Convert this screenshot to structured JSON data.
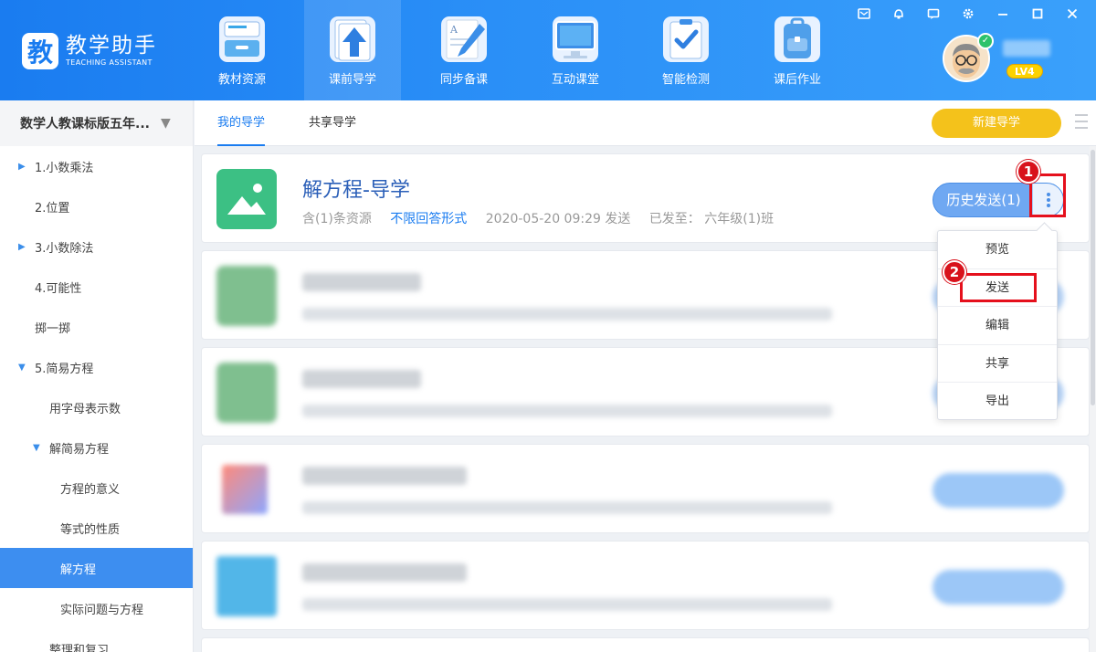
{
  "app": {
    "logo_char": "教",
    "name": "教学助手",
    "subtitle": "TEACHING ASSISTANT",
    "level": "LV4"
  },
  "nav": [
    {
      "label": "教材资源",
      "icon": "cabinet-icon",
      "active": false
    },
    {
      "label": "课前导学",
      "icon": "upload-book-icon",
      "active": true
    },
    {
      "label": "同步备课",
      "icon": "pen-paper-icon",
      "active": false
    },
    {
      "label": "互动课堂",
      "icon": "monitor-icon",
      "active": false
    },
    {
      "label": "智能检测",
      "icon": "checklist-icon",
      "active": false
    },
    {
      "label": "课后作业",
      "icon": "backpack-icon",
      "active": false
    }
  ],
  "window_controls": [
    "mail-icon",
    "bell-icon",
    "chat-icon",
    "gear-icon",
    "minimize-icon",
    "maximize-icon",
    "close-icon"
  ],
  "sidebar": {
    "grade": "数学人教课标版五年...",
    "items": [
      {
        "label": "1.小数乘法",
        "level": 0,
        "caret": "right",
        "selected": false
      },
      {
        "label": "2.位置",
        "level": 0,
        "caret": "",
        "selected": false
      },
      {
        "label": "3.小数除法",
        "level": 0,
        "caret": "right",
        "selected": false
      },
      {
        "label": "4.可能性",
        "level": 0,
        "caret": "",
        "selected": false
      },
      {
        "label": "掷一掷",
        "level": 0,
        "caret": "",
        "selected": false
      },
      {
        "label": "5.简易方程",
        "level": 0,
        "caret": "down",
        "selected": false
      },
      {
        "label": "用字母表示数",
        "level": 1,
        "caret": "",
        "selected": false
      },
      {
        "label": "解简易方程",
        "level": 1,
        "caret": "down",
        "selected": false
      },
      {
        "label": "方程的意义",
        "level": 2,
        "caret": "",
        "selected": false
      },
      {
        "label": "等式的性质",
        "level": 2,
        "caret": "",
        "selected": false
      },
      {
        "label": "解方程",
        "level": 2,
        "caret": "",
        "selected": true
      },
      {
        "label": "实际问题与方程",
        "level": 2,
        "caret": "",
        "selected": false
      },
      {
        "label": "整理和复习",
        "level": 1,
        "caret": "",
        "selected": false
      }
    ]
  },
  "tabs": [
    {
      "label": "我的导学",
      "active": true
    },
    {
      "label": "共享导学",
      "active": false
    }
  ],
  "new_button": "新建导学",
  "first_card": {
    "title": "解方程-导学",
    "resources": "含(1)条资源",
    "answer_form": "不限回答形式",
    "sent_time": "2020-05-20 09:29 发送",
    "sent_to": "已发至： 六年级(1)班",
    "history_button": "历史发送(1)"
  },
  "dropdown": [
    "预览",
    "发送",
    "编辑",
    "共享",
    "导出"
  ],
  "annotations": [
    "1",
    "2"
  ],
  "colors": {
    "topbar": "#1a7cf0",
    "accent_blue": "#1a7cf0",
    "new_button": "#f4c21b",
    "card_icon_green": "#3cc084",
    "selected_item": "#3d8ef0",
    "annotation_red": "#e5101c"
  }
}
